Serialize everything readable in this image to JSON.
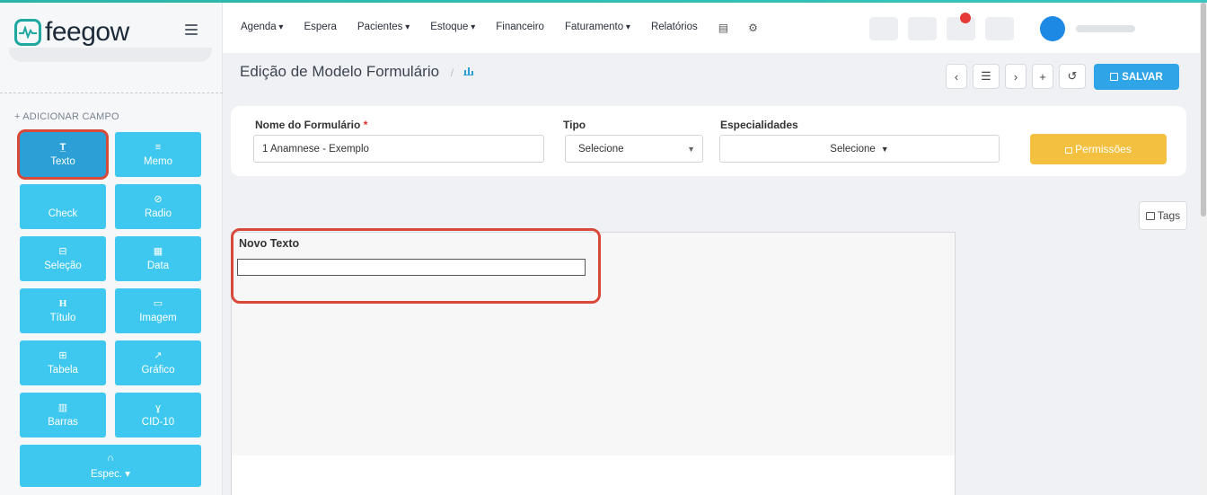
{
  "brand": {
    "name": "feegow",
    "color": "#1ea9a0"
  },
  "nav": {
    "items": [
      {
        "label": "Agenda",
        "dropdown": true
      },
      {
        "label": "Espera",
        "dropdown": false
      },
      {
        "label": "Pacientes",
        "dropdown": true
      },
      {
        "label": "Estoque",
        "dropdown": true
      },
      {
        "label": "Financeiro",
        "dropdown": false
      },
      {
        "label": "Faturamento",
        "dropdown": true
      },
      {
        "label": "Relatórios",
        "dropdown": false
      }
    ],
    "icons": [
      "database-icon",
      "gear-icon"
    ]
  },
  "page": {
    "title": "Edição de Modelo Formulário",
    "separator": "/",
    "toolbar": {
      "save_label": "SALVAR",
      "prev": "‹",
      "next": "›",
      "list": "☰",
      "add": "+",
      "history": "↺"
    }
  },
  "sidebar": {
    "add_field_label": "+ ADICIONAR CAMPO",
    "fields": [
      {
        "label": "Texto",
        "icon": "text-icon",
        "glyph": "T̲",
        "active": true
      },
      {
        "label": "Memo",
        "icon": "memo-icon",
        "glyph": "≡",
        "active": false
      },
      {
        "label": "Check",
        "icon": "check-icon",
        "glyph": "",
        "active": false
      },
      {
        "label": "Radio",
        "icon": "radio-icon",
        "glyph": "⊘",
        "active": false
      },
      {
        "label": "Seleção",
        "icon": "select-icon",
        "glyph": "⊟",
        "active": false
      },
      {
        "label": "Data",
        "icon": "calendar-icon",
        "glyph": "▦",
        "active": false
      },
      {
        "label": "Título",
        "icon": "heading-icon",
        "glyph": "H",
        "active": false
      },
      {
        "label": "Imagem",
        "icon": "image-icon",
        "glyph": "▭",
        "active": false
      },
      {
        "label": "Tabela",
        "icon": "table-icon",
        "glyph": "⊞",
        "active": false
      },
      {
        "label": "Gráfico",
        "icon": "chart-icon",
        "glyph": "↗",
        "active": false
      },
      {
        "label": "Barras",
        "icon": "barcode-icon",
        "glyph": "▥",
        "active": false
      },
      {
        "label": "CID-10",
        "icon": "stethoscope-icon",
        "glyph": "ɣ",
        "active": false
      },
      {
        "label": "Espec. ▾",
        "icon": "headset-icon",
        "glyph": "∩",
        "active": false
      }
    ]
  },
  "form": {
    "name_label": "Nome do Formulário",
    "required_mark": "*",
    "name_value": "1 Anamnese - Exemplo",
    "type_label": "Tipo",
    "type_value": "Selecione",
    "specialties_label": "Especialidades",
    "specialties_value": "Selecione",
    "permissions_label": "Permissões",
    "tags_label": "Tags"
  },
  "canvas": {
    "text_field_label": "Novo Texto",
    "text_field_value": ""
  },
  "colors": {
    "field_button": "#3ec8ef",
    "field_button_active": "#2b9fd6",
    "highlight": "#d9493a",
    "save": "#2fa4e7",
    "permissions": "#f4c040"
  }
}
